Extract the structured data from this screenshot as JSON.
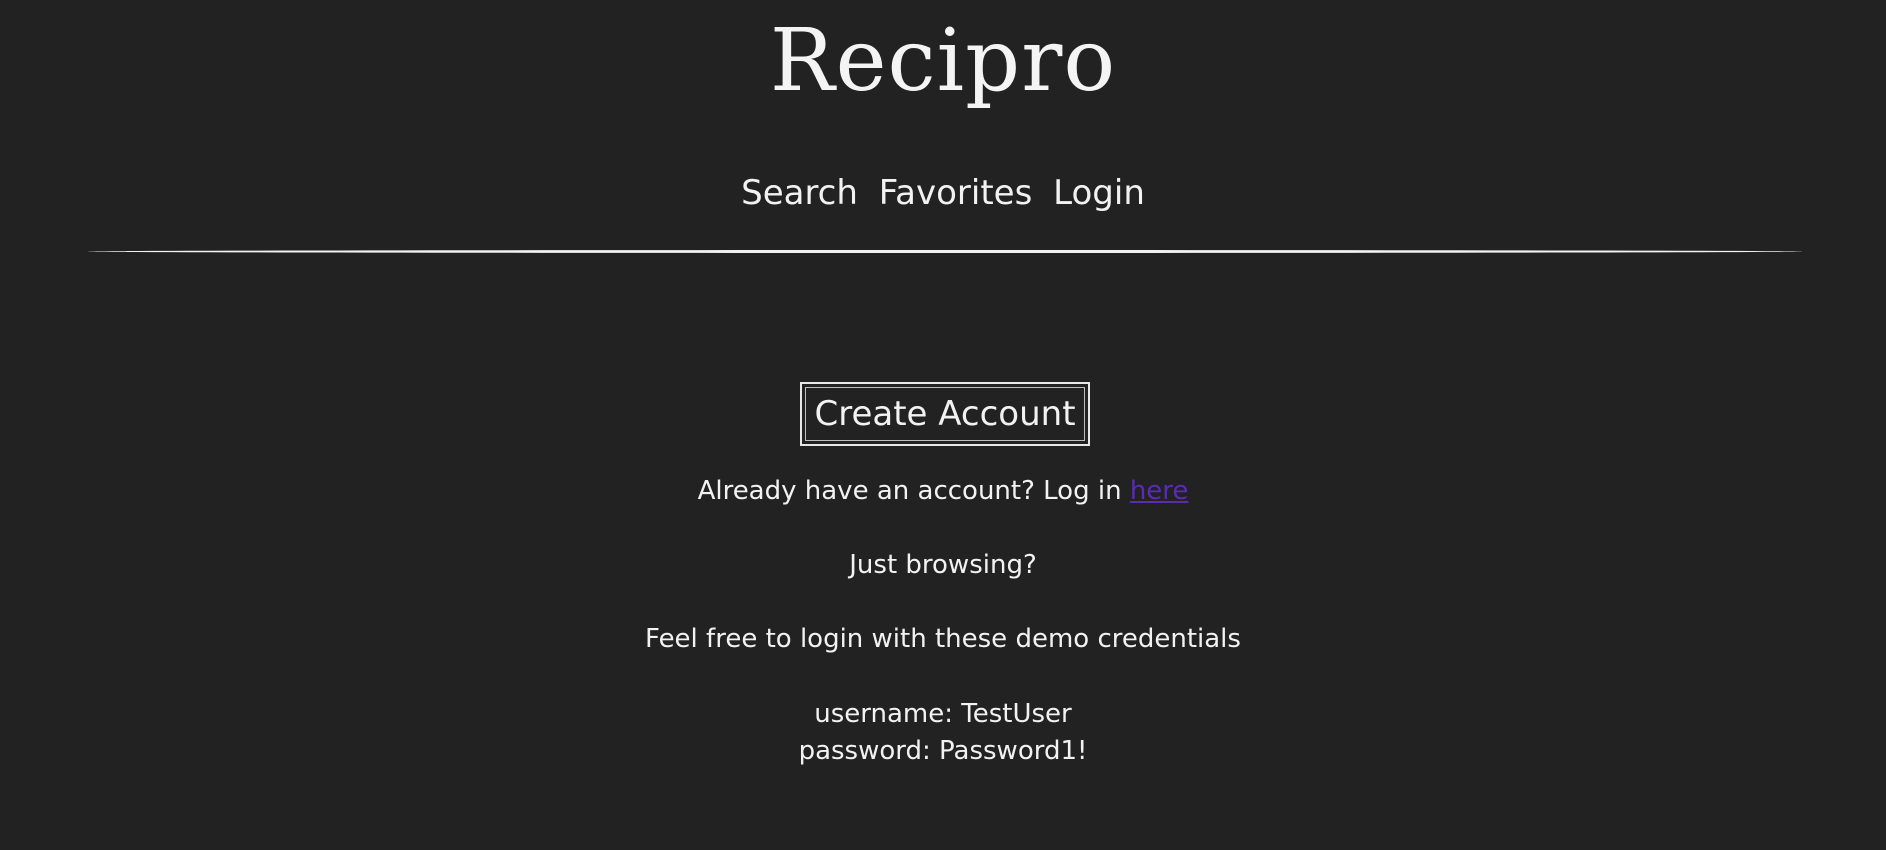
{
  "header": {
    "logo": "Recipro",
    "nav": [
      "Search",
      "Favorites",
      "Login"
    ]
  },
  "main": {
    "create_account_label": "Create Account",
    "already_text": "Already have an account? Log in ",
    "here_link": "here",
    "browsing_text": "Just browsing?",
    "demo_text": "Feel free to login with these demo credentials",
    "username_text": "username: TestUser",
    "password_text": "password: Password1!"
  },
  "colors": {
    "background": "#222222",
    "text": "#f2f2f2",
    "link": "#5b2bb0"
  }
}
